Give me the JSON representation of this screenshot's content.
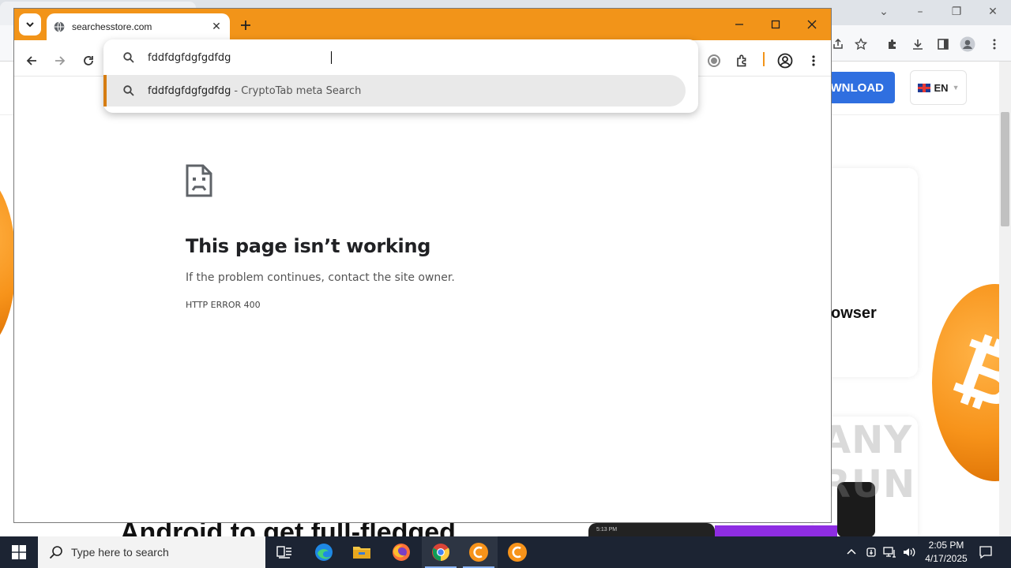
{
  "browser": {
    "tab_title": "searchesstore.com",
    "omnibox_value": "fddfdgfdgfgdfdg",
    "suggestion": {
      "query": "fddfdgfdgfgdfdg",
      "engine_label": "- CryptoTab meta Search"
    }
  },
  "error_page": {
    "title": "This page isn’t working",
    "message": "If the problem continues, contact the site owner.",
    "code": "HTTP ERROR 400"
  },
  "background_site": {
    "download_label": "WNLOAD",
    "language": "EN",
    "card_title": "owser",
    "headline": "Android to get full-fledged",
    "watermark": "ANY RUN"
  },
  "taskbar": {
    "search_placeholder": "Type here to search",
    "time": "2:05 PM",
    "date": "4/17/2025"
  },
  "colors": {
    "tabstrip_accent": "#f29419",
    "suggestion_marker": "#d67d12",
    "taskbar": "#1c2433",
    "download_button": "#2f6fe0"
  },
  "icons": [
    "chevron-down-icon",
    "globe-icon",
    "close-icon",
    "plus-icon",
    "minimize-icon",
    "maximize-icon",
    "back-icon",
    "forward-icon",
    "reload-icon",
    "search-icon",
    "cryptotab-icon",
    "extensions-icon",
    "profile-icon",
    "menu-icon",
    "sad-page-icon",
    "windows-icon",
    "task-view-icon",
    "edge-icon",
    "file-explorer-icon",
    "firefox-icon",
    "chrome-icon",
    "cryptotab-browser-icon",
    "network-icon",
    "volume-icon",
    "notification-icon"
  ]
}
